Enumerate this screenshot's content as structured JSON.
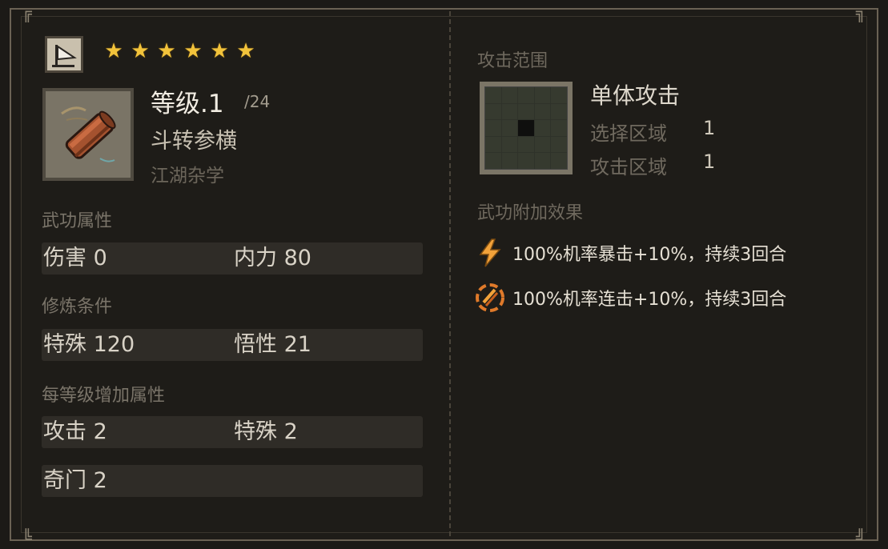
{
  "skill": {
    "stars": 6,
    "level_label": "等级.1",
    "level_max": "/24",
    "name": "斗转参横",
    "category": "江湖杂学",
    "item_icon": "scroll-icon",
    "category_icon": "flag-icon"
  },
  "sections": {
    "attributes_title": "武功属性",
    "requirements_title": "修炼条件",
    "per_level_title": "每等级增加属性"
  },
  "attributes": [
    {
      "label": "伤害",
      "value": "0"
    },
    {
      "label": "内力",
      "value": "80"
    }
  ],
  "requirements": [
    {
      "label": "特殊",
      "value": "120"
    },
    {
      "label": "悟性",
      "value": "21"
    }
  ],
  "per_level": [
    {
      "label": "攻击",
      "value": "2"
    },
    {
      "label": "特殊",
      "value": "2"
    },
    {
      "label": "奇门",
      "value": "2"
    }
  ],
  "range": {
    "title": "攻击范围",
    "type": "单体攻击",
    "select_label": "选择区域",
    "select_value": "1",
    "attack_label": "攻击区域",
    "attack_value": "1"
  },
  "effects": {
    "title": "武功附加效果",
    "items": [
      {
        "icon": "lightning-icon",
        "text": "100%机率暴击+10%，持续3回合",
        "color": "#f2a23a"
      },
      {
        "icon": "combo-slash-icon",
        "text": "100%机率连击+10%，持续3回合",
        "color": "#e07a2a"
      }
    ]
  },
  "colors": {
    "star": "#f2c33b",
    "background": "#1c1a17",
    "frame": "#6b6254"
  }
}
